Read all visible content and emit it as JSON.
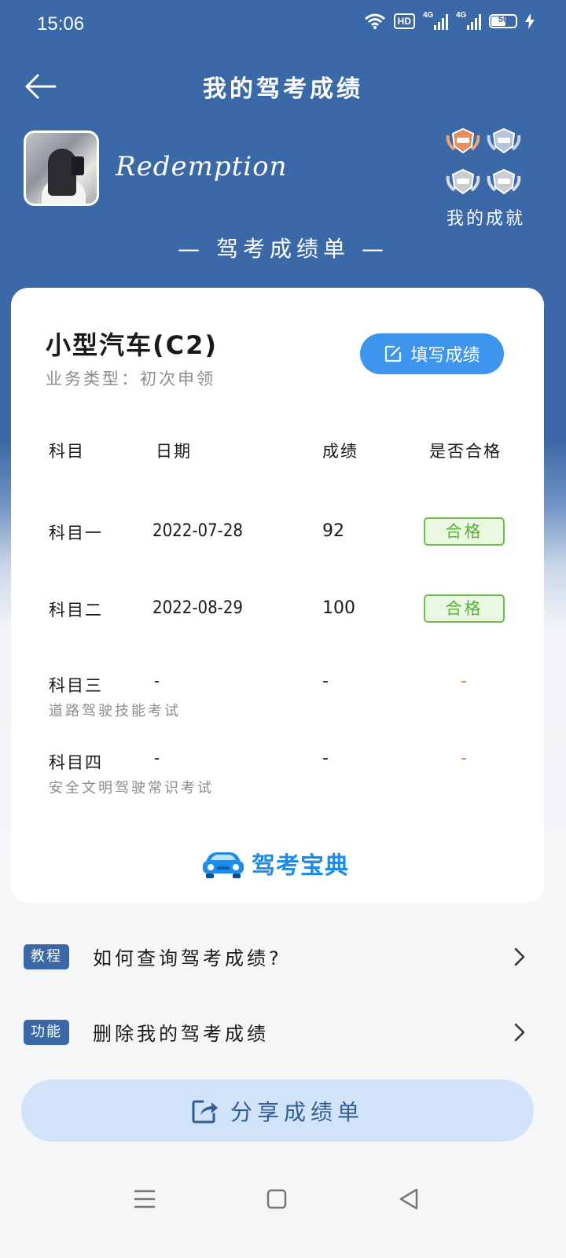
{
  "status_bar": {
    "time": "15:06",
    "hd": "HD",
    "signal1": "4G",
    "signal2": "4G",
    "battery": "50"
  },
  "header": {
    "title": "我的驾考成绩"
  },
  "profile": {
    "username": "Redemption",
    "achievements_label": "我的成就"
  },
  "section_title": "— 驾考成绩单 —",
  "card": {
    "car_type": "小型汽车(C2)",
    "business_type": "业务类型：初次申领",
    "fill_button": "填写成绩",
    "columns": [
      "科目",
      "日期",
      "成绩",
      "是否合格"
    ],
    "rows": [
      {
        "subject": "科目一",
        "date": "2022-07-28",
        "score": "92",
        "result": "合格",
        "desc": ""
      },
      {
        "subject": "科目二",
        "date": "2022-08-29",
        "score": "100",
        "result": "合格",
        "desc": ""
      },
      {
        "subject": "科目三",
        "date": "-",
        "score": "-",
        "result": "-",
        "desc": "道路驾驶技能考试"
      },
      {
        "subject": "科目四",
        "date": "-",
        "score": "-",
        "result": "-",
        "desc": "安全文明驾驶常识考试"
      }
    ],
    "brand": "驾考宝典"
  },
  "list": [
    {
      "tag": "教程",
      "text": "如何查询驾考成绩?"
    },
    {
      "tag": "功能",
      "text": "删除我的驾考成绩"
    }
  ],
  "share_button": "分享成绩单",
  "colors": {
    "primary": "#3b68a6",
    "accent": "#3e95ee",
    "pass": "#5bb238",
    "pending": "#ee6e2a"
  },
  "icons": [
    "back-arrow-icon",
    "edit-icon",
    "share-icon",
    "chevron-right-icon",
    "menu-icon",
    "home-icon",
    "back-triangle-icon"
  ]
}
